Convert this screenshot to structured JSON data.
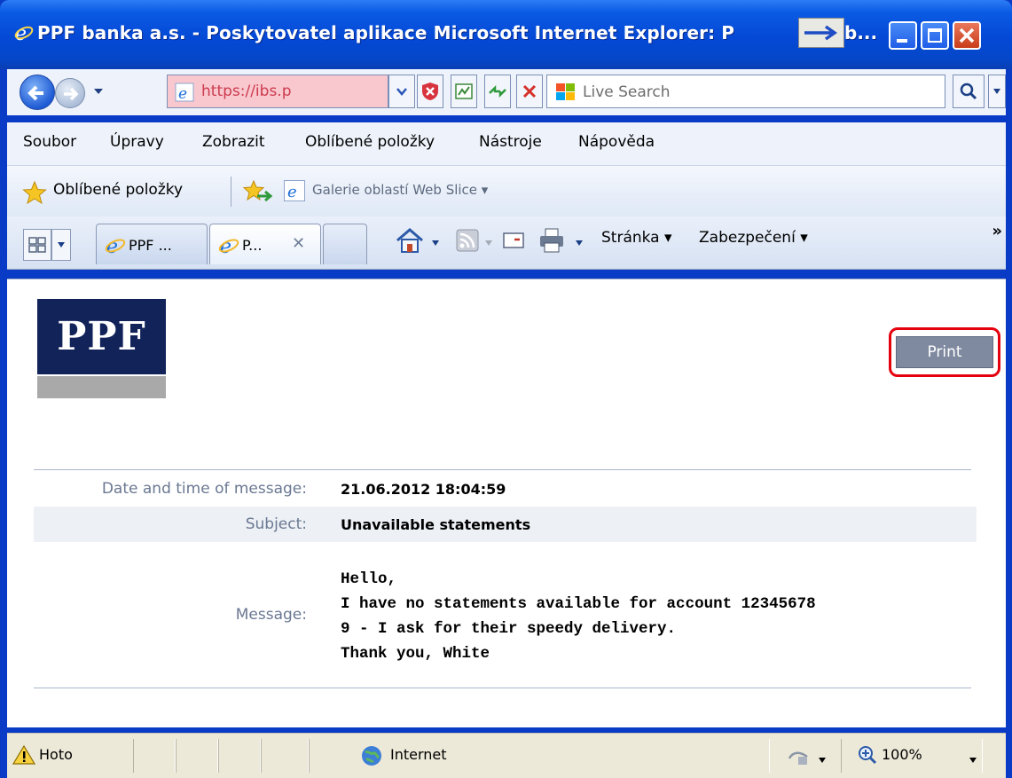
{
  "window": {
    "title": "PPF banka a.s. - Poskytovatel aplikace Microsoft Internet Explorer: P",
    "title_suffix": "b..."
  },
  "address": {
    "url": "https://ibs.p",
    "search_placeholder": "Live Search"
  },
  "menu": [
    "Soubor",
    "Úpravy",
    "Zobrazit",
    "Oblíbené položky",
    "Nástroje",
    "Nápověda"
  ],
  "favorites": {
    "label": "Oblíbené položky",
    "gallery": "Galerie oblastí Web Slice ▾"
  },
  "tabs": [
    {
      "label": "PPF ..."
    },
    {
      "label": "P..."
    }
  ],
  "commands": {
    "page": "Stránka ▾",
    "security": "Zabezpečení ▾"
  },
  "page": {
    "logo_text": "PPF",
    "print_label": "Print",
    "date_label": "Date and time of message:",
    "date_value": "21.06.2012 18:04:59",
    "subject_label": "Subject:",
    "subject_value": "Unavailable statements",
    "message_label": "Message:",
    "message_text": "Hello,\nI have no statements available for account 12345678\n9 - I ask for their speedy delivery.\nThank you, White"
  },
  "status": {
    "left": "Hoto",
    "zone": "Internet",
    "zoom": "100%"
  },
  "colors": {
    "highlight_ring": "#e5000e",
    "logo_navy": "#12235a",
    "print_button": "#7f8aa0"
  }
}
